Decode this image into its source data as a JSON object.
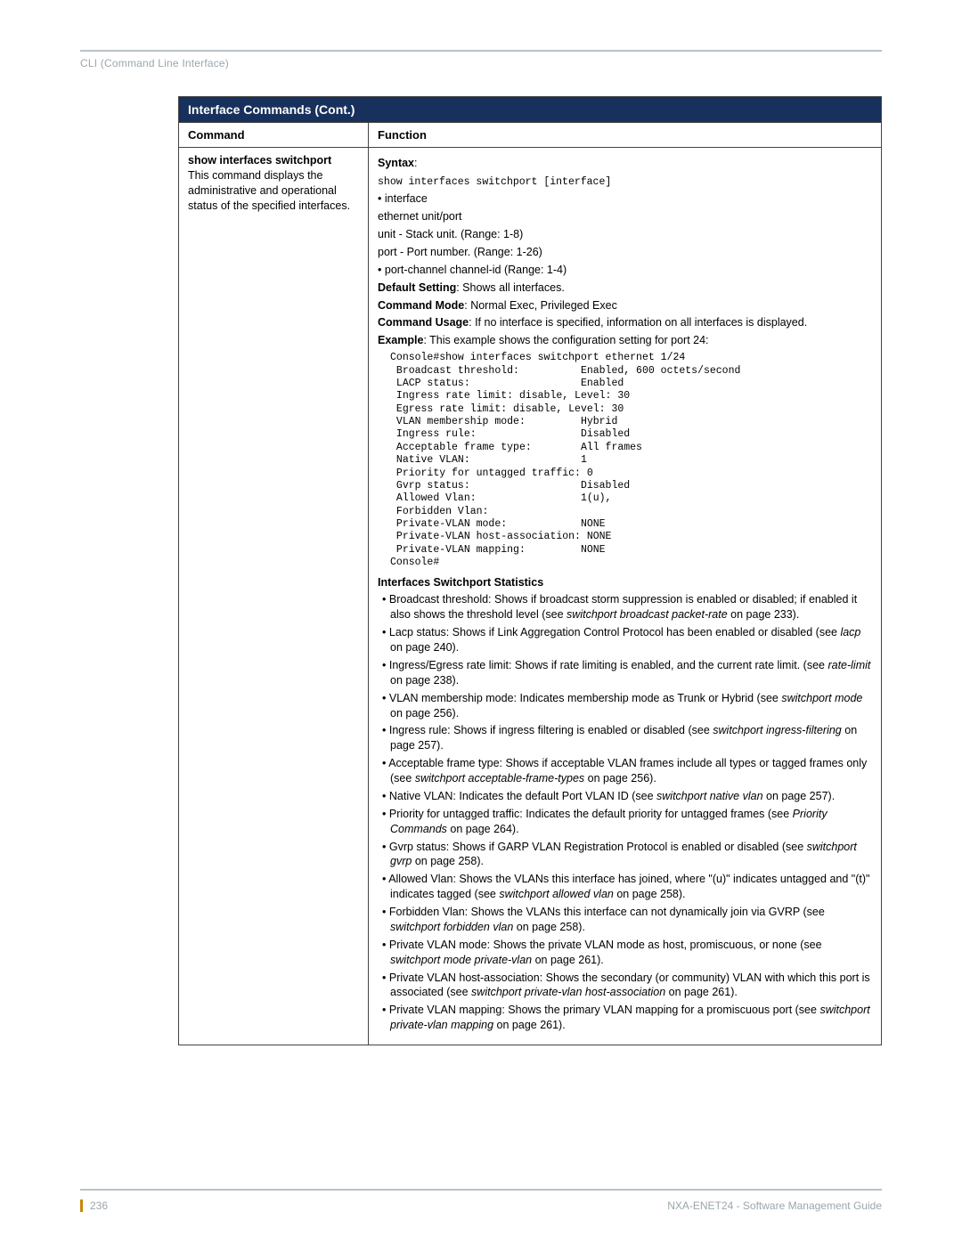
{
  "breadcrumb": "CLI (Command Line Interface)",
  "table_title": "Interface Commands (Cont.)",
  "col_headers": {
    "command": "Command",
    "function": "Function"
  },
  "cmd": {
    "name": "show interfaces switchport",
    "desc": "This command displays the administrative and operational status of the specified interfaces."
  },
  "func": {
    "syntax_label": "Syntax",
    "syntax_line": "show interfaces switchport [interface]",
    "iface_label": "• interface",
    "eth_label": "ethernet unit/port",
    "unit_label": "unit - Stack unit. (Range: 1-8)",
    "port_label": "port - Port number. (Range: 1-26)",
    "pc_label": "• port-channel channel-id (Range: 1-4)",
    "default_label": "Default Setting",
    "default_text": ": Shows all interfaces.",
    "mode_label": "Command Mode",
    "mode_text": ": Normal Exec, Privileged Exec",
    "usage_label": "Command Usage",
    "usage_text": ": If no interface is specified, information on all interfaces is displayed.",
    "example_label": "Example",
    "example_text": ": This example shows the configuration setting for port 24:",
    "example_block": "Console#show interfaces switchport ethernet 1/24\n Broadcast threshold:          Enabled, 600 octets/second\n LACP status:                  Enabled\n Ingress rate limit: disable, Level: 30\n Egress rate limit: disable, Level: 30\n VLAN membership mode:         Hybrid\n Ingress rule:                 Disabled\n Acceptable frame type:        All frames\n Native VLAN:                  1\n Priority for untagged traffic: 0\n Gvrp status:                  Disabled\n Allowed Vlan:                 1(u),\n Forbidden Vlan:\n Private-VLAN mode:            NONE\n Private-VLAN host-association: NONE\n Private-VLAN mapping:         NONE\nConsole#",
    "stats_heading": "Interfaces Switchport Statistics",
    "b1a": "Broadcast threshold: Shows if broadcast storm suppression is enabled or disabled; if enabled it also shows the threshold level (see ",
    "b1i": "switchport broadcast packet-rate",
    "b1b": " on page 233).",
    "b2a": "Lacp status: Shows if Link Aggregation Control Protocol has been enabled or disabled (see ",
    "b2i": "lacp",
    "b2b": " on page 240).",
    "b3a": "Ingress/Egress rate limit: Shows if rate limiting is enabled, and the current rate limit. (see ",
    "b3i": "rate-limit",
    "b3b": " on page 238).",
    "b4a": "VLAN membership mode: Indicates membership mode as Trunk or Hybrid (see ",
    "b4i": "switchport mode",
    "b4b": " on page 256).",
    "b5a": "Ingress rule: Shows if ingress filtering is enabled or disabled (see ",
    "b5i": "switchport ingress-filtering",
    "b5b": " on page 257).",
    "b6a": "Acceptable frame type: Shows if acceptable VLAN frames include all types or tagged frames only (see ",
    "b6i": "switchport acceptable-frame-types",
    "b6b": " on page 256).",
    "b7a": "Native VLAN: Indicates the default Port VLAN ID (see ",
    "b7i": "switchport native vlan",
    "b7b": " on page 257).",
    "b8a": "Priority for untagged traffic: Indicates the default priority for untagged frames (see ",
    "b8i": "Priority Commands",
    "b8b": " on page 264).",
    "b9a": "Gvrp status: Shows if GARP VLAN Registration Protocol is enabled or disabled (see ",
    "b9i": "switchport gvrp",
    "b9b": " on page 258).",
    "b10a": "Allowed Vlan: Shows the VLANs this interface has joined, where \"(u)\" indicates untagged and \"(t)\" indicates tagged (see ",
    "b10i": "switchport allowed vlan",
    "b10b": " on page 258).",
    "b11a": "Forbidden Vlan: Shows the VLANs this interface can not dynamically join via GVRP (see ",
    "b11i": "switchport forbidden vlan",
    "b11b": " on page 258).",
    "b12a": "Private VLAN mode: Shows the private VLAN mode as host, promiscuous, or none (see ",
    "b12i": "switchport mode private-vlan",
    "b12b": " on page 261).",
    "b13a": "Private VLAN host-association: Shows the secondary (or community) VLAN with which this port is associated (see ",
    "b13i": "switchport private-vlan host-association",
    "b13b": " on page 261).",
    "b14a": "Private VLAN mapping: Shows the primary VLAN mapping for a promiscuous port (see ",
    "b14i": "switchport private-vlan mapping",
    "b14b": " on page 261)."
  },
  "footer": {
    "page": "236",
    "guide": "NXA-ENET24 - Software Management Guide"
  }
}
